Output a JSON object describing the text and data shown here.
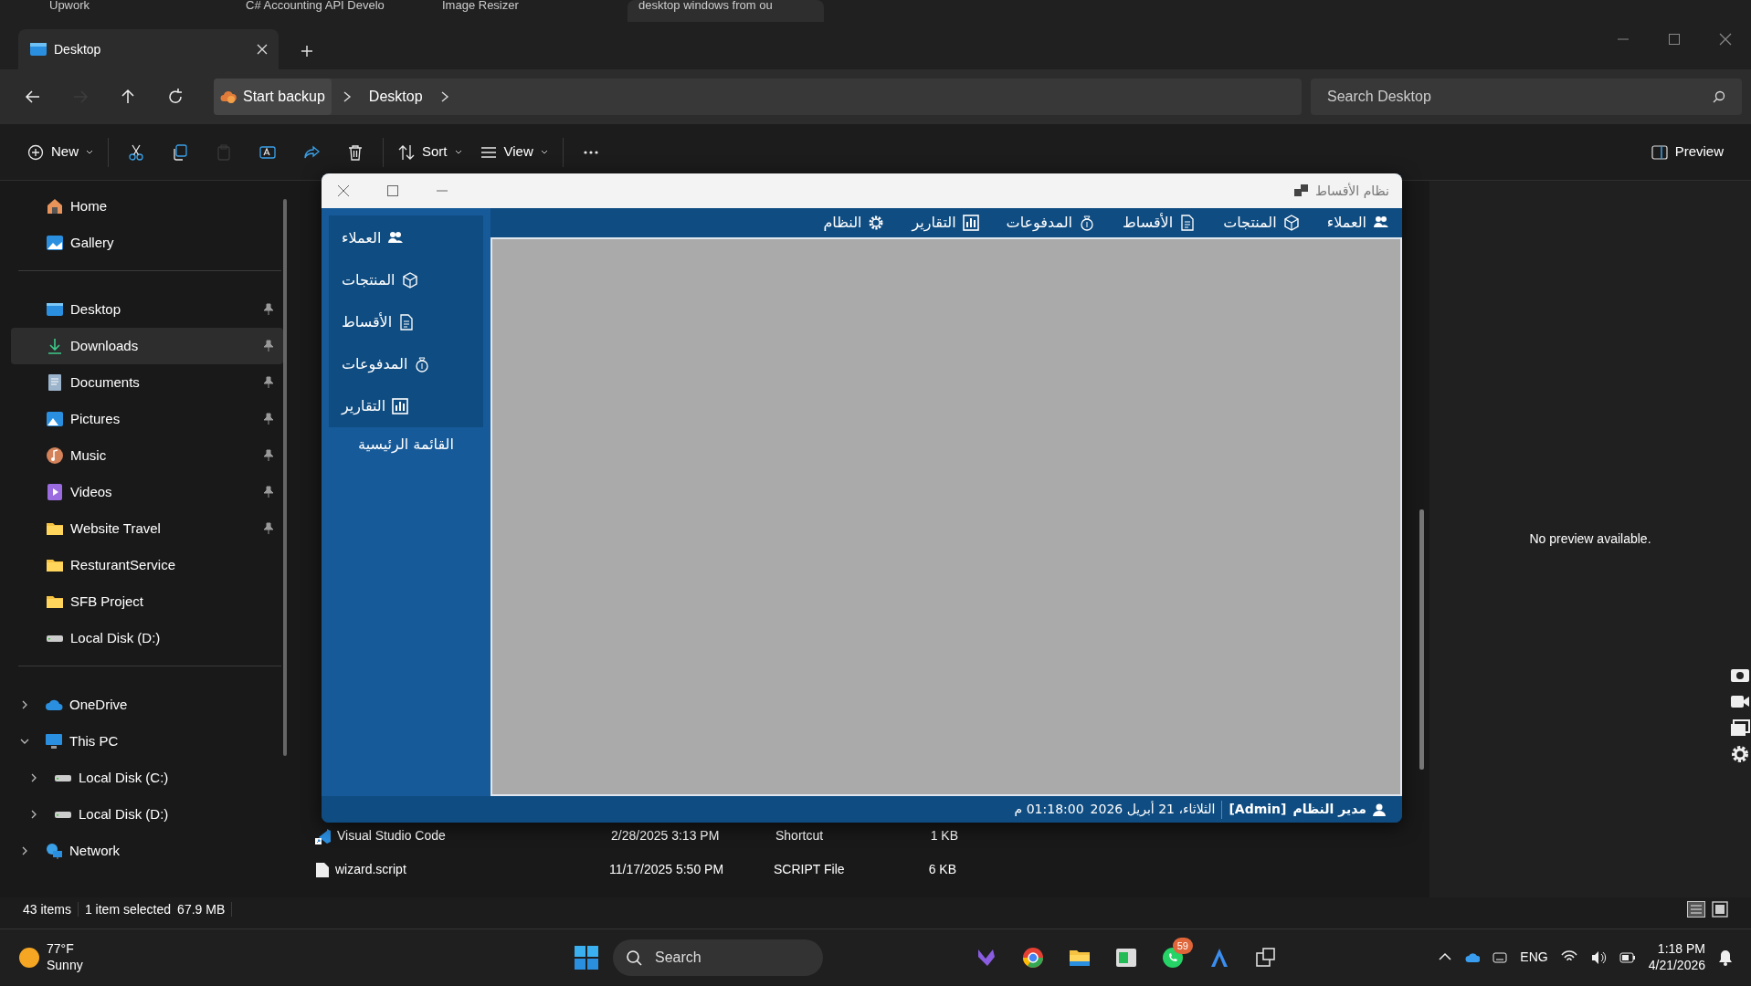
{
  "browser_tabs": [
    {
      "label": "Upwork",
      "selected": false
    },
    {
      "label": "C# Accounting API Develo",
      "selected": false
    },
    {
      "label": "Image Resizer",
      "selected": false
    },
    {
      "label": "desktop windows from ou",
      "selected": true
    }
  ],
  "explorer": {
    "tab": {
      "title": "Desktop"
    },
    "nav_buttons": [
      {
        "kind": "back",
        "disabled": false
      },
      {
        "kind": "forward",
        "disabled": true
      },
      {
        "kind": "up",
        "disabled": false
      },
      {
        "kind": "refresh",
        "disabled": false
      }
    ],
    "breadcrumb": [
      "Start backup",
      "Desktop"
    ],
    "search": {
      "placeholder": "Search Desktop"
    },
    "commands": [
      {
        "kind": "new",
        "label": "New"
      },
      {
        "kind": "cut"
      },
      {
        "kind": "copy"
      },
      {
        "kind": "paste",
        "disabled": true
      },
      {
        "kind": "rename"
      },
      {
        "kind": "share"
      },
      {
        "kind": "delete"
      },
      {
        "kind": "sort",
        "label": "Sort"
      },
      {
        "kind": "view",
        "label": "View"
      },
      {
        "kind": "more"
      }
    ],
    "preview_button": {
      "label": "Preview"
    },
    "sidebar": {
      "quick": [
        {
          "kind": "home",
          "label": "Home",
          "selected": false
        },
        {
          "kind": "gallery",
          "label": "Gallery",
          "selected": false
        }
      ],
      "pinned": [
        {
          "kind": "desktop",
          "label": "Desktop",
          "pinned": true,
          "selected": false
        },
        {
          "kind": "download",
          "label": "Downloads",
          "pinned": true,
          "selected": true
        },
        {
          "kind": "documents",
          "label": "Documents",
          "pinned": true,
          "selected": false
        },
        {
          "kind": "pictures",
          "label": "Pictures",
          "pinned": true,
          "selected": false
        },
        {
          "kind": "music",
          "label": "Music",
          "pinned": true,
          "selected": false
        },
        {
          "kind": "videos",
          "label": "Videos",
          "pinned": true,
          "selected": false
        },
        {
          "kind": "folder",
          "label": "Website Travel",
          "pinned": true,
          "selected": false
        },
        {
          "kind": "folder",
          "label": "ResturantService",
          "pinned": false,
          "selected": false
        },
        {
          "kind": "folder",
          "label": "SFB Project",
          "pinned": false,
          "selected": false
        },
        {
          "kind": "disk",
          "label": "Local Disk (D:)",
          "pinned": false,
          "selected": false
        }
      ],
      "tree": [
        {
          "kind": "cloud",
          "label": "OneDrive",
          "expanded": false
        },
        {
          "kind": "pc",
          "label": "This PC",
          "expanded": true,
          "children": [
            {
              "kind": "disk",
              "label": "Local Disk (C:)",
              "expanded": false
            },
            {
              "kind": "disk",
              "label": "Local Disk (D:)",
              "expanded": false
            }
          ]
        },
        {
          "kind": "network",
          "label": "Network",
          "expanded": false
        }
      ]
    },
    "files": [
      {
        "kind": "shortcut",
        "name": "Visual Studio Code",
        "date": "2/28/2025 3:13 PM",
        "type": "Shortcut",
        "size": "1 KB"
      },
      {
        "kind": "file",
        "name": "wizard.script",
        "date": "11/17/2025 5:50 PM",
        "type": "SCRIPT File",
        "size": "6 KB"
      }
    ],
    "preview_message": "No preview available.",
    "status_bar": {
      "count": "43 items",
      "selection": "1 item selected",
      "size": "67.9 MB"
    }
  },
  "app_window": {
    "title": "نظام الأقساط",
    "menu": [
      {
        "kind": "users",
        "label": "العملاء"
      },
      {
        "kind": "box",
        "label": "المنتجات"
      },
      {
        "kind": "doc",
        "label": "الأقساط"
      },
      {
        "kind": "money",
        "label": "المدفوعات"
      },
      {
        "kind": "chart",
        "label": "التقارير"
      },
      {
        "kind": "gear",
        "label": "النظام"
      }
    ],
    "side_menu": [
      {
        "kind": "users",
        "label": "العملاء"
      },
      {
        "kind": "box",
        "label": "المنتجات"
      },
      {
        "kind": "doc",
        "label": "الأقساط"
      },
      {
        "kind": "money",
        "label": "المدفوعات"
      },
      {
        "kind": "chart",
        "label": "التقارير"
      }
    ],
    "side_heading": "القائمة الرئيسية",
    "status": {
      "user": "مدير النظام",
      "role": "[Admin]",
      "date": "الثلاثاء، 21 أبريل 2026",
      "time": "01:18:00 م"
    }
  },
  "taskbar": {
    "weather": {
      "temperature": "77°F",
      "condition": "Sunny"
    },
    "search": {
      "placeholder": "Search"
    },
    "apps": [
      {
        "kind": "vs"
      },
      {
        "kind": "chrome"
      },
      {
        "kind": "files"
      },
      {
        "kind": "terminal"
      },
      {
        "kind": "whatsapp",
        "badge": "59"
      },
      {
        "kind": "arrow"
      },
      {
        "kind": "windows"
      }
    ],
    "language": "ENG",
    "time": "1:18 PM",
    "date": "4/21/2026"
  }
}
